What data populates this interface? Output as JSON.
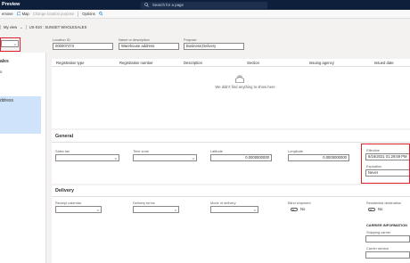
{
  "app": {
    "title": "Preview"
  },
  "search": {
    "placeholder": "Search for a page"
  },
  "actionbar": {
    "remove_label": "emove",
    "map_label": "Map",
    "change_purpose_label": "Change location purpose",
    "options_label": "Options"
  },
  "breadcrumb": {
    "my_view": "My view",
    "record": "US-010 : SUNSET WHOLESALES"
  },
  "left_panel": {
    "item1": "ales",
    "item2": "o",
    "item3": "ddress"
  },
  "header_fields": {
    "location_id": {
      "label": "Location ID",
      "value": "000007473"
    },
    "name": {
      "label": "Name or description",
      "value": "Warehouse address"
    },
    "purpose": {
      "label": "Purpose",
      "value": "Business;Delivery"
    }
  },
  "registration_grid": {
    "columns": [
      "Registration type",
      "Registration number",
      "Description",
      "Section",
      "Issuing agency",
      "Issued date"
    ],
    "empty_message": "We didn't find anything to show here"
  },
  "general": {
    "title": "General",
    "sales_tax": {
      "label": "Sales tax"
    },
    "time_zone": {
      "label": "Time zone"
    },
    "latitude": {
      "label": "Latitude",
      "value": "0.0000000000"
    },
    "longitude": {
      "label": "Longitude",
      "value": "0.0000000000"
    },
    "effective": {
      "label": "Effective",
      "value": "6/16/2021 01:29:59 PM"
    },
    "expiration": {
      "label": "Expiration",
      "value": "Never"
    }
  },
  "delivery": {
    "title": "Delivery",
    "receipt_calendar": {
      "label": "Receipt calendar"
    },
    "delivery_terms": {
      "label": "Delivery terms"
    },
    "mode_of_delivery": {
      "label": "Mode of delivery"
    },
    "blind_shipment": {
      "label": "Blind shipment",
      "value": "No"
    },
    "residential_destination": {
      "label": "Residential destination",
      "value": "No"
    },
    "carrier_information": "CARRIER INFORMATION",
    "shipping_carrier": {
      "label": "Shipping carrier"
    },
    "carrier_service": {
      "label": "Carrier service"
    }
  },
  "colors": {
    "topbar": "#0d1f3a",
    "selection": "#cfe4fa",
    "highlight": "#e0202a"
  }
}
